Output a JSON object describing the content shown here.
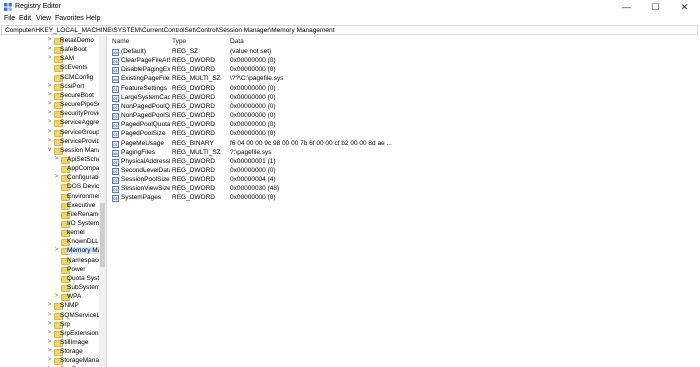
{
  "window": {
    "title": "Registry Editor"
  },
  "window_controls": {
    "minimize": "—",
    "maximize": "☐",
    "close": "✕"
  },
  "menu": [
    "File",
    "Edit",
    "View",
    "Favorites",
    "Help"
  ],
  "address": "Computer\\HKEY_LOCAL_MACHINE\\SYSTEM\\CurrentControlSet\\Control\\Session Manager\\Memory Management",
  "columns": {
    "name": "Name",
    "type": "Type",
    "data": "Data"
  },
  "tree": [
    {
      "label": "RetailDemo",
      "expand": ">"
    },
    {
      "label": "SafeBoot",
      "expand": ">"
    },
    {
      "label": "SAM",
      "expand": ">"
    },
    {
      "label": "ScEvents",
      "expand": ""
    },
    {
      "label": "SCMConfig",
      "expand": ""
    },
    {
      "label": "ScsiPort",
      "expand": ">"
    },
    {
      "label": "SecureBoot",
      "expand": ">"
    },
    {
      "label": "SecurePipeServers",
      "expand": ">"
    },
    {
      "label": "SecurityProviders",
      "expand": ">"
    },
    {
      "label": "ServiceAggregatedEvents",
      "expand": ">"
    },
    {
      "label": "ServiceGroupOrder",
      "expand": ">"
    },
    {
      "label": "ServiceProvider",
      "expand": ">"
    },
    {
      "label": "Session Manager",
      "expand": "v"
    },
    {
      "label": "ApiSetSchemaExtensions",
      "expand": ">"
    },
    {
      "label": "AppCompatCache",
      "expand": ""
    },
    {
      "label": "Configuration Manager",
      "expand": ">"
    },
    {
      "label": "DOS Devices",
      "expand": ""
    },
    {
      "label": "Environment",
      "expand": ""
    },
    {
      "label": "Executive",
      "expand": ""
    },
    {
      "label": "FileRenameOperations",
      "expand": ""
    },
    {
      "label": "I/O System",
      "expand": ""
    },
    {
      "label": "kernel",
      "expand": ""
    },
    {
      "label": "KnownDLLs",
      "expand": ""
    },
    {
      "label": "Memory Management",
      "expand": ">",
      "selected": true
    },
    {
      "label": "Namespace Separation",
      "expand": ""
    },
    {
      "label": "Power",
      "expand": ""
    },
    {
      "label": "Quota System",
      "expand": ""
    },
    {
      "label": "SubSystems",
      "expand": ""
    },
    {
      "label": "WPA",
      "expand": ">"
    },
    {
      "label": "SNMP",
      "expand": ">"
    },
    {
      "label": "SQMServiceList",
      "expand": ">"
    },
    {
      "label": "Srp",
      "expand": ">"
    },
    {
      "label": "SrpExtensionConfig",
      "expand": ">"
    },
    {
      "label": "StillImage",
      "expand": ">"
    },
    {
      "label": "Storage",
      "expand": ">"
    },
    {
      "label": "StorageManagement",
      "expand": ">"
    },
    {
      "label": "StorPort",
      "expand": ">"
    }
  ],
  "values": [
    {
      "name": "(Default)",
      "type": "REG_SZ",
      "data": "(value not set)",
      "icon": "ab"
    },
    {
      "name": "ClearPageFileAtShutdown",
      "type": "REG_DWORD",
      "data": "0x00000000 (0)",
      "icon": "01"
    },
    {
      "name": "DisablePagingExecutive",
      "type": "REG_DWORD",
      "data": "0x00000000 (0)",
      "icon": "01"
    },
    {
      "name": "ExistingPageFiles",
      "type": "REG_MULTI_SZ",
      "data": "\\??\\C:\\pagefile.sys",
      "icon": "ab"
    },
    {
      "name": "FeatureSettings",
      "type": "REG_DWORD",
      "data": "0x00000000 (0)",
      "icon": "01"
    },
    {
      "name": "LargeSystemCache",
      "type": "REG_DWORD",
      "data": "0x00000000 (0)",
      "icon": "01"
    },
    {
      "name": "NonPagedPoolQuota",
      "type": "REG_DWORD",
      "data": "0x00000000 (0)",
      "icon": "01"
    },
    {
      "name": "NonPagedPoolSize",
      "type": "REG_DWORD",
      "data": "0x00000000 (0)",
      "icon": "01"
    },
    {
      "name": "PagedPoolQuota",
      "type": "REG_DWORD",
      "data": "0x00000000 (0)",
      "icon": "01"
    },
    {
      "name": "PagedPoolSize",
      "type": "REG_DWORD",
      "data": "0x00000000 (0)",
      "icon": "01"
    },
    {
      "name": "PageMeUsage",
      "type": "REG_BINARY",
      "data": "f6 04 00 00 9c 98 00 00 7b 6f 00 00 cf b2 00 00 8d ae ...",
      "icon": "01"
    },
    {
      "name": "PagingFiles",
      "type": "REG_MULTI_SZ",
      "data": "?:\\pagefile.sys",
      "icon": "ab"
    },
    {
      "name": "PhysicalAddressExtension",
      "type": "REG_DWORD",
      "data": "0x00000001 (1)",
      "icon": "01"
    },
    {
      "name": "SecondLevelDataCache",
      "type": "REG_DWORD",
      "data": "0x00000000 (0)",
      "icon": "01"
    },
    {
      "name": "SessionPoolSize",
      "type": "REG_DWORD",
      "data": "0x00000004 (4)",
      "icon": "01"
    },
    {
      "name": "SessionViewSize",
      "type": "REG_DWORD",
      "data": "0x00000030 (48)",
      "icon": "01"
    },
    {
      "name": "SystemPages",
      "type": "REG_DWORD",
      "data": "0x00000000 (0)",
      "icon": "01"
    }
  ]
}
